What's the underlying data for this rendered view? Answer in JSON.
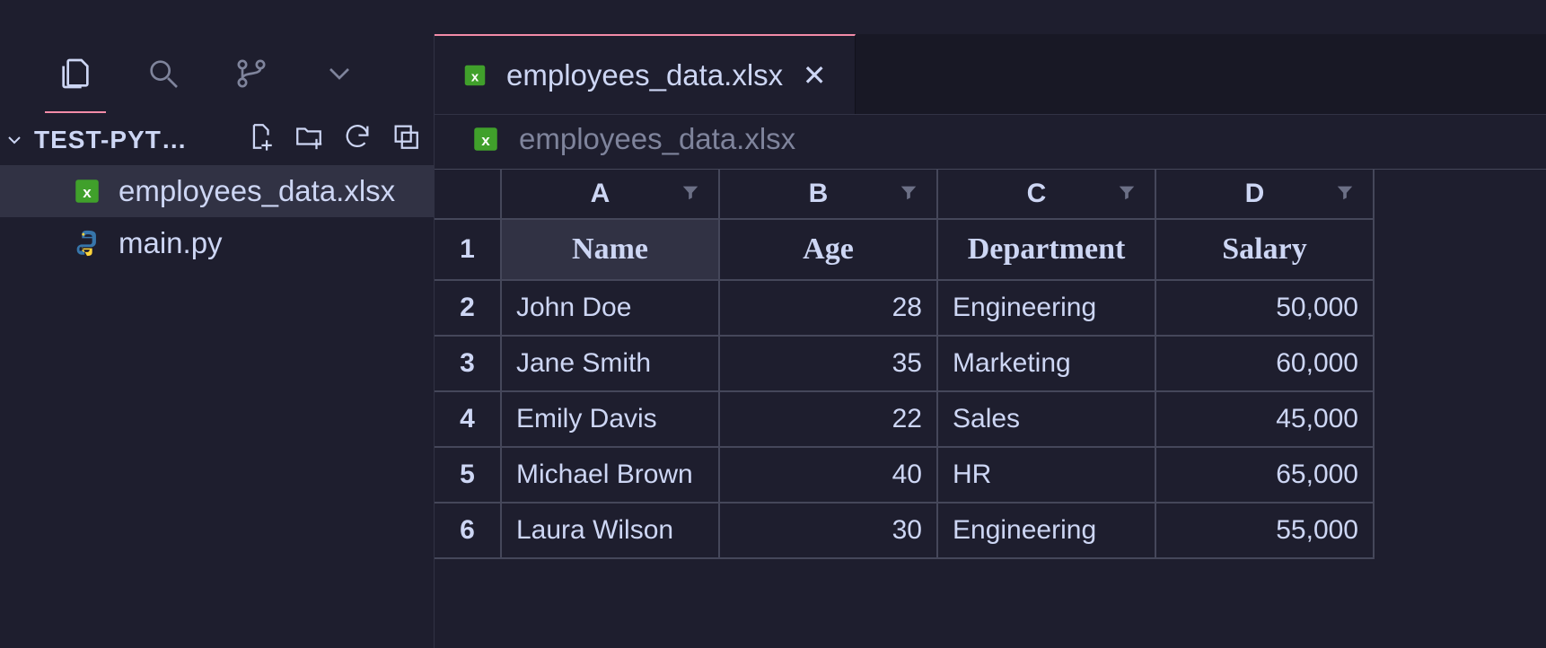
{
  "sidebar": {
    "project_name": "TEST-PYT…",
    "files": [
      {
        "name": "employees_data.xlsx",
        "type": "xlsx",
        "selected": true
      },
      {
        "name": "main.py",
        "type": "python",
        "selected": false
      }
    ]
  },
  "tabs": [
    {
      "label": "employees_data.xlsx",
      "type": "xlsx",
      "active": true
    }
  ],
  "breadcrumb": {
    "label": "employees_data.xlsx"
  },
  "sheet": {
    "columns": [
      "A",
      "B",
      "C",
      "D"
    ],
    "headers": [
      "Name",
      "Age",
      "Department",
      "Salary"
    ],
    "rows": [
      {
        "n": "1",
        "cells": [
          "Name",
          "Age",
          "Department",
          "Salary"
        ],
        "is_header": true
      },
      {
        "n": "2",
        "cells": [
          "John Doe",
          "28",
          "Engineering",
          "50,000"
        ]
      },
      {
        "n": "3",
        "cells": [
          "Jane Smith",
          "35",
          "Marketing",
          "60,000"
        ]
      },
      {
        "n": "4",
        "cells": [
          "Emily Davis",
          "22",
          "Sales",
          "45,000"
        ]
      },
      {
        "n": "5",
        "cells": [
          "Michael Brown",
          "40",
          "HR",
          "65,000"
        ]
      },
      {
        "n": "6",
        "cells": [
          "Laura Wilson",
          "30",
          "Engineering",
          "55,000"
        ]
      }
    ],
    "selected_cell": {
      "row": 0,
      "col": 0
    }
  },
  "chart_data": {
    "type": "table",
    "columns": [
      "Name",
      "Age",
      "Department",
      "Salary"
    ],
    "data": [
      [
        "John Doe",
        28,
        "Engineering",
        50000
      ],
      [
        "Jane Smith",
        35,
        "Marketing",
        60000
      ],
      [
        "Emily Davis",
        22,
        "Sales",
        45000
      ],
      [
        "Michael Brown",
        40,
        "HR",
        65000
      ],
      [
        "Laura Wilson",
        30,
        "Engineering",
        55000
      ]
    ]
  }
}
